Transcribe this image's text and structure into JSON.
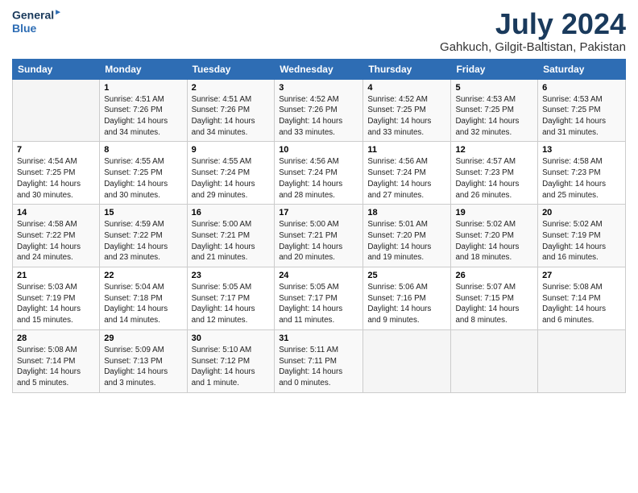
{
  "header": {
    "logo_line1": "General",
    "logo_line2": "Blue",
    "month_year": "July 2024",
    "location": "Gahkuch, Gilgit-Baltistan, Pakistan"
  },
  "weekdays": [
    "Sunday",
    "Monday",
    "Tuesday",
    "Wednesday",
    "Thursday",
    "Friday",
    "Saturday"
  ],
  "weeks": [
    [
      {
        "day": "",
        "info": ""
      },
      {
        "day": "1",
        "info": "Sunrise: 4:51 AM\nSunset: 7:26 PM\nDaylight: 14 hours\nand 34 minutes."
      },
      {
        "day": "2",
        "info": "Sunrise: 4:51 AM\nSunset: 7:26 PM\nDaylight: 14 hours\nand 34 minutes."
      },
      {
        "day": "3",
        "info": "Sunrise: 4:52 AM\nSunset: 7:26 PM\nDaylight: 14 hours\nand 33 minutes."
      },
      {
        "day": "4",
        "info": "Sunrise: 4:52 AM\nSunset: 7:25 PM\nDaylight: 14 hours\nand 33 minutes."
      },
      {
        "day": "5",
        "info": "Sunrise: 4:53 AM\nSunset: 7:25 PM\nDaylight: 14 hours\nand 32 minutes."
      },
      {
        "day": "6",
        "info": "Sunrise: 4:53 AM\nSunset: 7:25 PM\nDaylight: 14 hours\nand 31 minutes."
      }
    ],
    [
      {
        "day": "7",
        "info": "Sunrise: 4:54 AM\nSunset: 7:25 PM\nDaylight: 14 hours\nand 30 minutes."
      },
      {
        "day": "8",
        "info": "Sunrise: 4:55 AM\nSunset: 7:25 PM\nDaylight: 14 hours\nand 30 minutes."
      },
      {
        "day": "9",
        "info": "Sunrise: 4:55 AM\nSunset: 7:24 PM\nDaylight: 14 hours\nand 29 minutes."
      },
      {
        "day": "10",
        "info": "Sunrise: 4:56 AM\nSunset: 7:24 PM\nDaylight: 14 hours\nand 28 minutes."
      },
      {
        "day": "11",
        "info": "Sunrise: 4:56 AM\nSunset: 7:24 PM\nDaylight: 14 hours\nand 27 minutes."
      },
      {
        "day": "12",
        "info": "Sunrise: 4:57 AM\nSunset: 7:23 PM\nDaylight: 14 hours\nand 26 minutes."
      },
      {
        "day": "13",
        "info": "Sunrise: 4:58 AM\nSunset: 7:23 PM\nDaylight: 14 hours\nand 25 minutes."
      }
    ],
    [
      {
        "day": "14",
        "info": "Sunrise: 4:58 AM\nSunset: 7:22 PM\nDaylight: 14 hours\nand 24 minutes."
      },
      {
        "day": "15",
        "info": "Sunrise: 4:59 AM\nSunset: 7:22 PM\nDaylight: 14 hours\nand 23 minutes."
      },
      {
        "day": "16",
        "info": "Sunrise: 5:00 AM\nSunset: 7:21 PM\nDaylight: 14 hours\nand 21 minutes."
      },
      {
        "day": "17",
        "info": "Sunrise: 5:00 AM\nSunset: 7:21 PM\nDaylight: 14 hours\nand 20 minutes."
      },
      {
        "day": "18",
        "info": "Sunrise: 5:01 AM\nSunset: 7:20 PM\nDaylight: 14 hours\nand 19 minutes."
      },
      {
        "day": "19",
        "info": "Sunrise: 5:02 AM\nSunset: 7:20 PM\nDaylight: 14 hours\nand 18 minutes."
      },
      {
        "day": "20",
        "info": "Sunrise: 5:02 AM\nSunset: 7:19 PM\nDaylight: 14 hours\nand 16 minutes."
      }
    ],
    [
      {
        "day": "21",
        "info": "Sunrise: 5:03 AM\nSunset: 7:19 PM\nDaylight: 14 hours\nand 15 minutes."
      },
      {
        "day": "22",
        "info": "Sunrise: 5:04 AM\nSunset: 7:18 PM\nDaylight: 14 hours\nand 14 minutes."
      },
      {
        "day": "23",
        "info": "Sunrise: 5:05 AM\nSunset: 7:17 PM\nDaylight: 14 hours\nand 12 minutes."
      },
      {
        "day": "24",
        "info": "Sunrise: 5:05 AM\nSunset: 7:17 PM\nDaylight: 14 hours\nand 11 minutes."
      },
      {
        "day": "25",
        "info": "Sunrise: 5:06 AM\nSunset: 7:16 PM\nDaylight: 14 hours\nand 9 minutes."
      },
      {
        "day": "26",
        "info": "Sunrise: 5:07 AM\nSunset: 7:15 PM\nDaylight: 14 hours\nand 8 minutes."
      },
      {
        "day": "27",
        "info": "Sunrise: 5:08 AM\nSunset: 7:14 PM\nDaylight: 14 hours\nand 6 minutes."
      }
    ],
    [
      {
        "day": "28",
        "info": "Sunrise: 5:08 AM\nSunset: 7:14 PM\nDaylight: 14 hours\nand 5 minutes."
      },
      {
        "day": "29",
        "info": "Sunrise: 5:09 AM\nSunset: 7:13 PM\nDaylight: 14 hours\nand 3 minutes."
      },
      {
        "day": "30",
        "info": "Sunrise: 5:10 AM\nSunset: 7:12 PM\nDaylight: 14 hours\nand 1 minute."
      },
      {
        "day": "31",
        "info": "Sunrise: 5:11 AM\nSunset: 7:11 PM\nDaylight: 14 hours\nand 0 minutes."
      },
      {
        "day": "",
        "info": ""
      },
      {
        "day": "",
        "info": ""
      },
      {
        "day": "",
        "info": ""
      }
    ]
  ]
}
